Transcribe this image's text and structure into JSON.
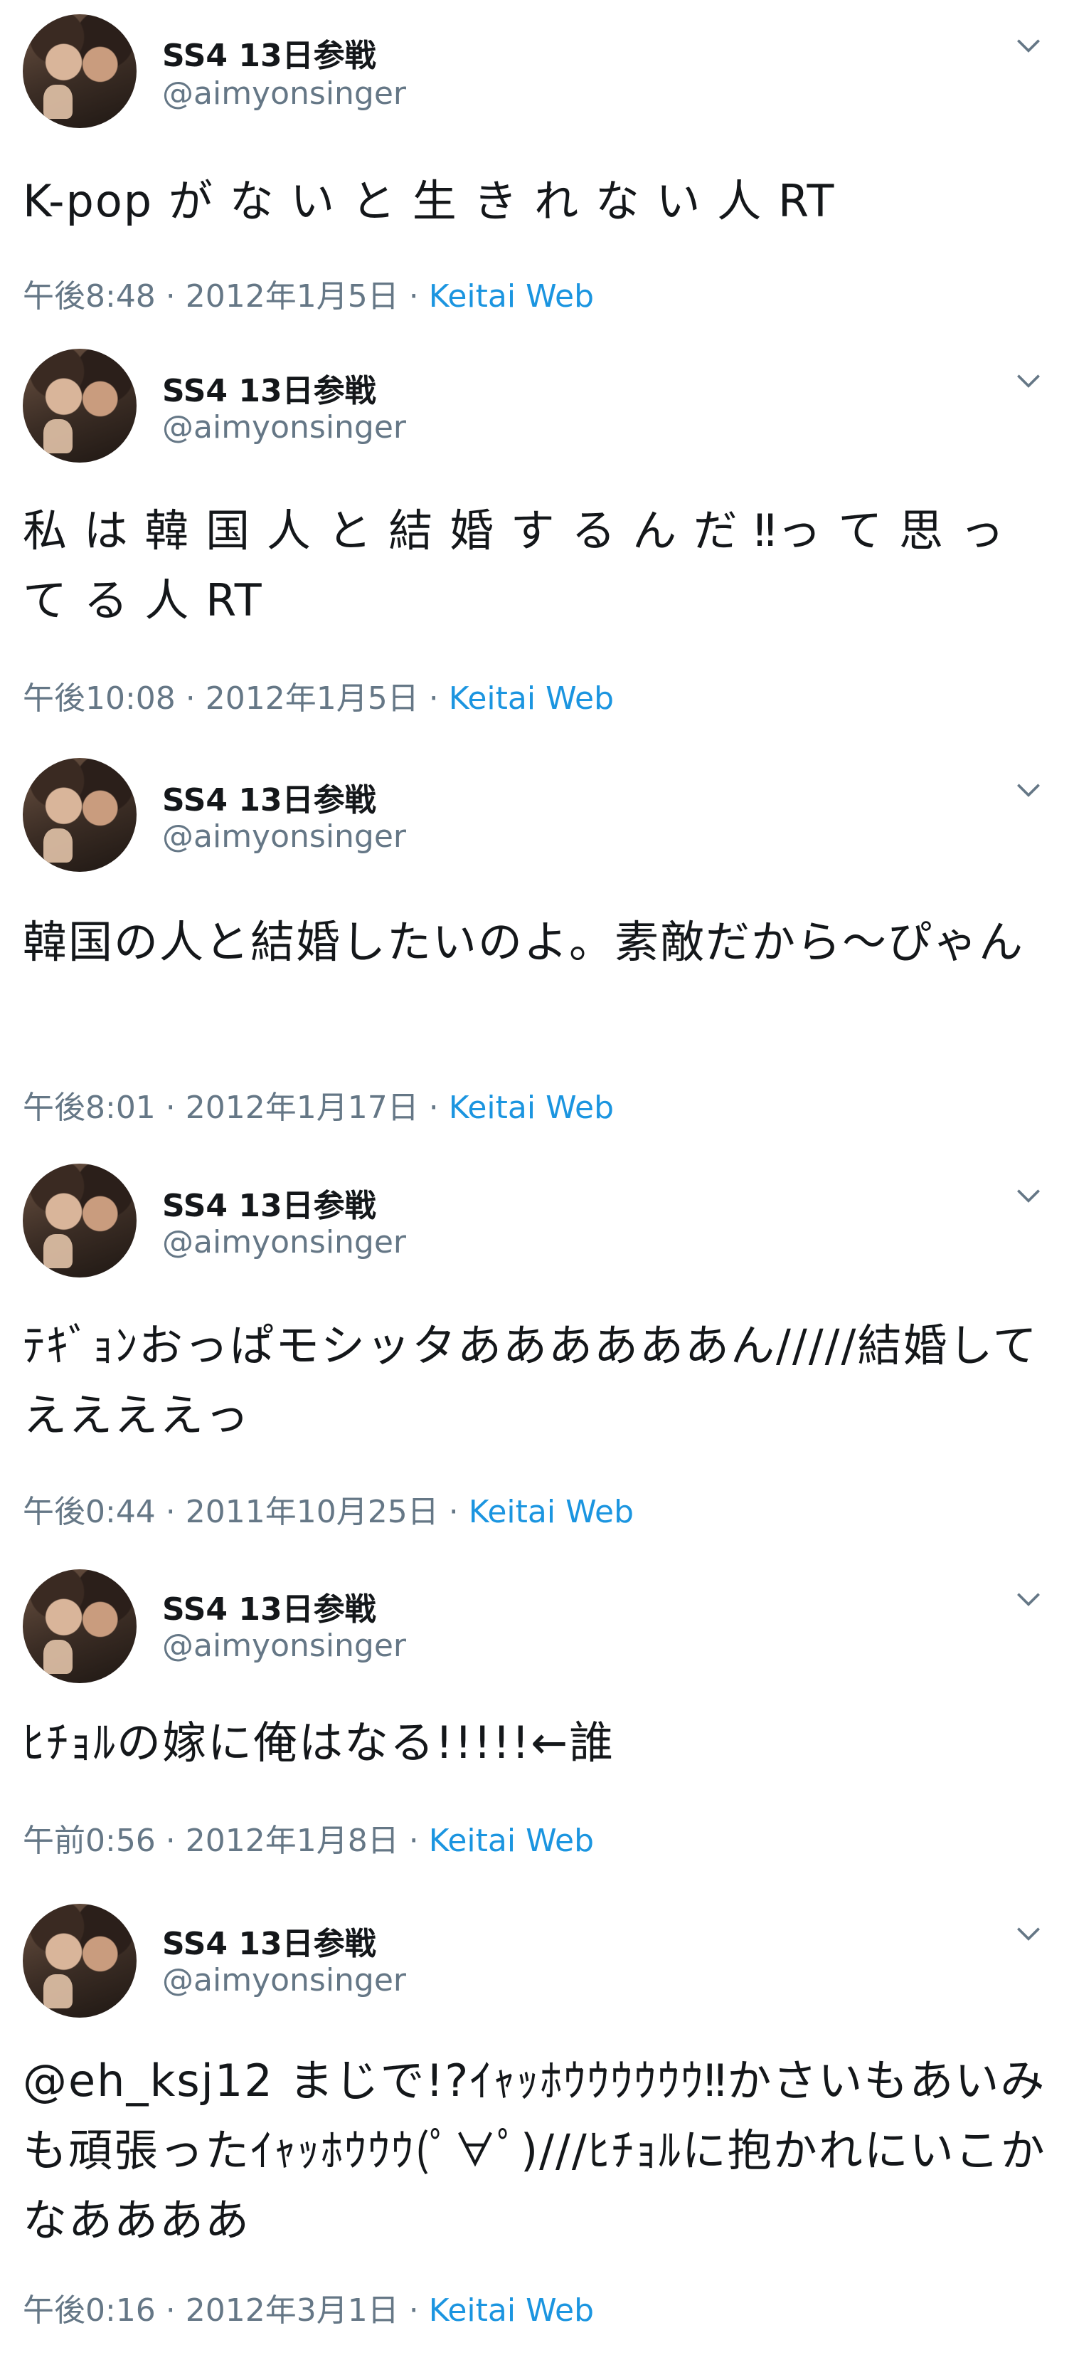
{
  "user": {
    "display_name": "SS4 13日参戦",
    "handle": "@aimyonsinger"
  },
  "tweets": [
    {
      "text": "K-pop が な い と 生 き れ な い 人 RT",
      "timestamp": "午後8:48 · 2012年1月5日 ·",
      "source": "Keitai Web"
    },
    {
      "text": "私 は 韓 国 人 と 結 婚 す る ん だ ‼っ て 思 っ て る 人 RT",
      "timestamp": "午後10:08 · 2012年1月5日 ·",
      "source": "Keitai Web"
    },
    {
      "text": "韓国の人と結婚したいのよ。素敵だから〜ぴゃん",
      "timestamp": "午後8:01 · 2012年1月17日 ·",
      "source": "Keitai Web"
    },
    {
      "text": "ﾃｷﾞｮﾝおっぱモシッタああああああん/////結婚してええええっ",
      "timestamp": "午後0:44 · 2011年10月25日 ·",
      "source": "Keitai Web"
    },
    {
      "text": "ﾋﾁｮﾙの嫁に俺はなる!!!!!←誰",
      "timestamp": "午前0:56 · 2012年1月8日 ·",
      "source": "Keitai Web"
    },
    {
      "text": "@eh_ksj12 まじで!?ｲｬｯﾎｳｳｳｳｳｳ‼かさいもあいみも頑張ったｲｬｯﾎｳｳｳ(ﾟ∀ﾟ)///ﾋﾁｮﾙに抱かれにいこかなああああ",
      "timestamp": "午後0:16 · 2012年3月1日 ·",
      "source": "Keitai Web"
    }
  ],
  "icons": {
    "menu": "chevron-down-icon",
    "avatar": "profile-photo"
  },
  "colors": {
    "source_link": "#1b95e0",
    "muted": "#657786",
    "text": "#14171a"
  }
}
